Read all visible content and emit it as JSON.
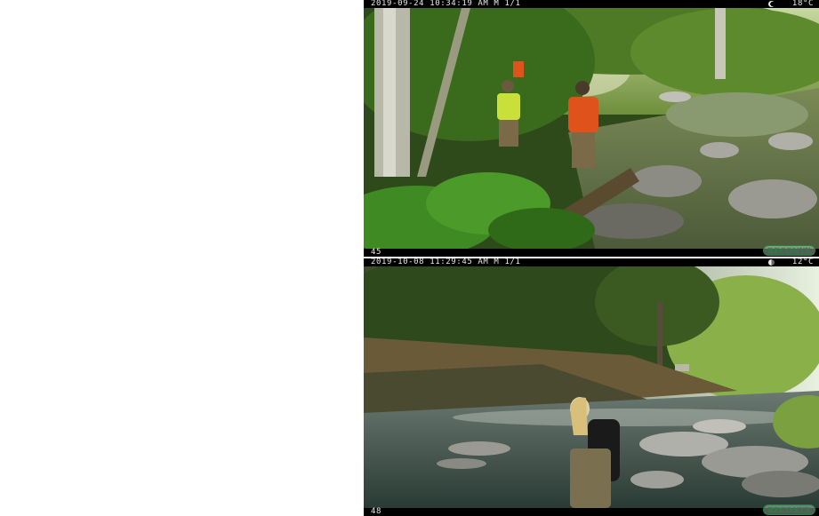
{
  "frames": [
    {
      "timestamp": "2019-09-24 10:34:19 AM  M 1/1",
      "temperature": "18°C",
      "camera_id": "45",
      "brand": "RECONYX"
    },
    {
      "timestamp": "2019-10-08 11:29:45 AM  M 1/1",
      "temperature": "12°C",
      "camera_id": "48",
      "brand": "RECONYX"
    }
  ],
  "colors": {
    "foliage": "#3f7a22",
    "water": "#3a4a40",
    "vest_orange": "#e0521c",
    "vest_yellow": "#c9e03a"
  }
}
